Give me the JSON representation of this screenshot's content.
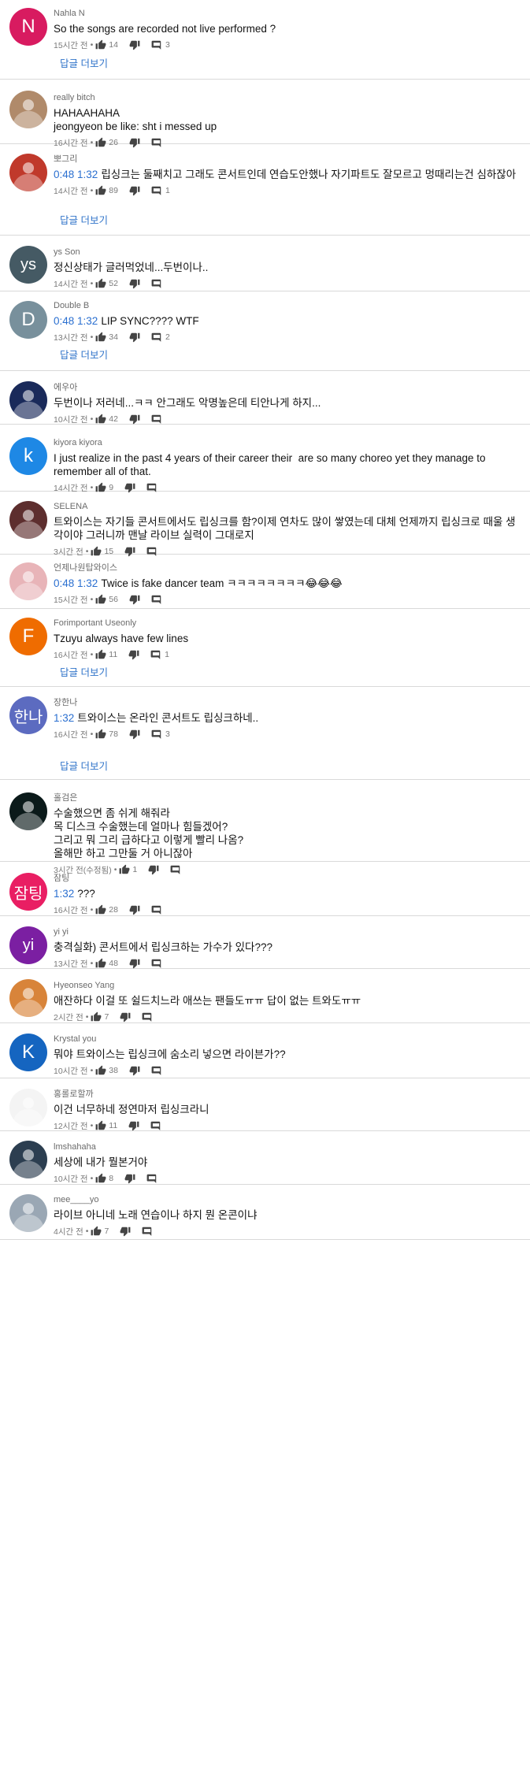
{
  "comments": [
    {
      "author": "Nahla N",
      "avatar": {
        "letter": "N",
        "bg": "#d81b60"
      },
      "ts": "",
      "text": "So the songs are recorded not live performed ?",
      "time": "15시간 전",
      "likes": "14",
      "replies": "3",
      "more": "답글 더보기"
    },
    {
      "author": "really bitch",
      "avatar": {
        "letter": "",
        "bg": "#b08a6a"
      },
      "ts": "",
      "text": "HAHAAHAHA\njeongyeon be like: sht i messed up",
      "time": "16시간 전",
      "likes": "26",
      "replies": "",
      "more": ""
    },
    {
      "author": "뽀그리",
      "avatar": {
        "letter": "",
        "bg": "#c0392b"
      },
      "ts": "0:48 1:32",
      "text": "립싱크는 둘째치고 그래도 콘서트인데 연습도안했나 자기파트도 잘모르고 멍때리는건 심하잖아",
      "time": "14시간 전",
      "likes": "89",
      "replies": "1",
      "more": "답글 더보기"
    },
    {
      "author": "ys Son",
      "avatar": {
        "letter": "ys",
        "bg": "#455a64"
      },
      "ts": "",
      "text": "정신상태가 글러먹었네...두번이나..",
      "time": "14시간 전",
      "likes": "52",
      "replies": "",
      "more": ""
    },
    {
      "author": "Double B",
      "avatar": {
        "letter": "D",
        "bg": "#78909c"
      },
      "ts": "0:48 1:32",
      "text": "LIP SYNC???? WTF",
      "time": "13시간 전",
      "likes": "34",
      "replies": "2",
      "more": "답글 더보기"
    },
    {
      "author": "에우아",
      "avatar": {
        "letter": "",
        "bg": "#1a2a5a"
      },
      "ts": "",
      "text": "두번이나 저러네...ㅋㅋ 안그래도 악명높은데 티안나게 하지...",
      "time": "10시간 전",
      "likes": "42",
      "replies": "",
      "more": ""
    },
    {
      "author": "kiyora kiyora",
      "avatar": {
        "letter": "k",
        "bg": "#1e88e5"
      },
      "ts": "",
      "text": "I just realize in the past 4 years of their career their  are so many choreo yet they manage to remember all of that.",
      "time": "14시간 전",
      "likes": "9",
      "replies": "",
      "more": ""
    },
    {
      "author": "SELENA",
      "avatar": {
        "letter": "",
        "bg": "#5d2e2e"
      },
      "ts": "",
      "text": "트와이스는 자기들 콘서트에서도 립싱크를 함?이제 연차도 많이 쌓였는데 대체 언제까지 립싱크로 때울 생각이야 그러니까 맨날 라이브 실력이 그대로지",
      "time": "3시간 전",
      "likes": "15",
      "replies": "",
      "more": ""
    },
    {
      "author": "언제나원탑와이스",
      "avatar": {
        "letter": "",
        "bg": "#e8b4b8"
      },
      "ts": "0:48 1:32",
      "text": "Twice is fake dancer team ㅋㅋㅋㅋㅋㅋㅋㅋ😂😂😂",
      "time": "15시간 전",
      "likes": "56",
      "replies": "",
      "more": ""
    },
    {
      "author": "Forimportant Useonly",
      "avatar": {
        "letter": "F",
        "bg": "#ef6c00"
      },
      "ts": "",
      "text": "Tzuyu always have few lines",
      "time": "16시간 전",
      "likes": "11",
      "replies": "1",
      "more": "답글 더보기"
    },
    {
      "author": "장한나",
      "avatar": {
        "letter": "한나",
        "bg": "#5c6bc0"
      },
      "ts": "1:32",
      "text": "트와이스는 온라인 콘서트도 립싱크하네..",
      "time": "16시간 전",
      "likes": "78",
      "replies": "3",
      "more": "답글 더보기"
    },
    {
      "author": "홀검은",
      "avatar": {
        "letter": "",
        "bg": "#0b1a1a"
      },
      "ts": "",
      "text": "수술했으면 좀 쉬게 해줘라\n목 디스크 수술했는데 얼마나 힘들겠어?\n그리고 뭐 그리 급하다고 이렇게 빨리 나옴?\n올해만 하고 그만둘 거 아니잖아",
      "time": "3시간 전(수정됨)",
      "likes": "1",
      "replies": "",
      "more": ""
    },
    {
      "author": "잠팅",
      "avatar": {
        "letter": "잠팅",
        "bg": "#e91e63"
      },
      "ts": "1:32",
      "text": "???",
      "time": "16시간 전",
      "likes": "28",
      "replies": "",
      "more": ""
    },
    {
      "author": "yi yi",
      "avatar": {
        "letter": "yi",
        "bg": "#7b1fa2"
      },
      "ts": "",
      "text": "충격실화) 콘서트에서 립싱크하는 가수가 있다???",
      "time": "13시간 전",
      "likes": "48",
      "replies": "",
      "more": ""
    },
    {
      "author": "Hyeonseo Yang",
      "avatar": {
        "letter": "",
        "bg": "#d8843a"
      },
      "ts": "",
      "text": "애잔하다 이걸 또 쉴드치느라 애쓰는 팬들도ㅠㅠ 답이 없는 트와도ㅠㅠ",
      "time": "2시간 전",
      "likes": "7",
      "replies": "",
      "more": ""
    },
    {
      "author": "Krystal you",
      "avatar": {
        "letter": "K",
        "bg": "#1565c0"
      },
      "ts": "",
      "text": "뭐야 트와이스는 립싱크에 숨소리 넣으면 라이븐가??",
      "time": "10시간 전",
      "likes": "38",
      "replies": "",
      "more": ""
    },
    {
      "author": "홍롤로할까",
      "avatar": {
        "letter": "",
        "bg": "#f4f4f4"
      },
      "ts": "",
      "text": "이건 너무하네 정연마저 립싱크라니",
      "time": "12시간 전",
      "likes": "11",
      "replies": "",
      "more": ""
    },
    {
      "author": "lmshahaha",
      "avatar": {
        "letter": "",
        "bg": "#2c3e50"
      },
      "ts": "",
      "text": "세상에 내가 뭘본거야",
      "time": "10시간 전",
      "likes": "8",
      "replies": "",
      "more": ""
    },
    {
      "author": "mee____yo",
      "avatar": {
        "letter": "",
        "bg": "#9aa7b4"
      },
      "ts": "",
      "text": "라이브 아니네 노래 연습이나 하지 뭔 온콘이냐",
      "time": "4시간 전",
      "likes": "7",
      "replies": "",
      "more": ""
    }
  ]
}
